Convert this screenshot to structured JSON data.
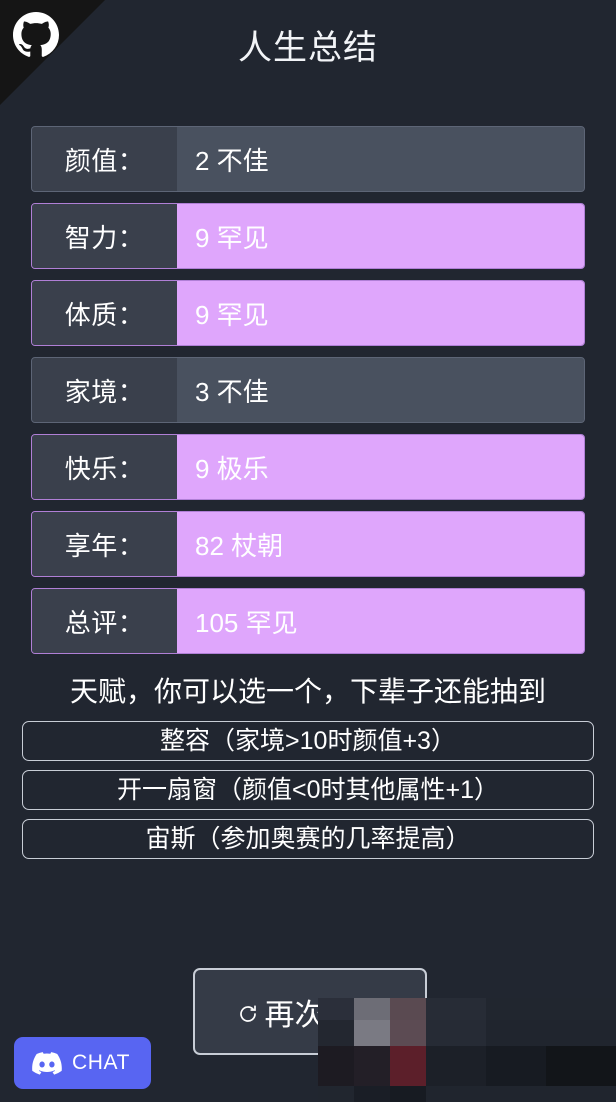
{
  "header": {
    "title": "人生总结",
    "corner_icon": "github-octocat-icon"
  },
  "stats": {
    "rows": [
      {
        "label": "颜值：",
        "value": "2 不佳",
        "highlight": false
      },
      {
        "label": "智力：",
        "value": "9 罕见",
        "highlight": true
      },
      {
        "label": "体质：",
        "value": "9 罕见",
        "highlight": true
      },
      {
        "label": "家境：",
        "value": "3 不佳",
        "highlight": false
      },
      {
        "label": "快乐：",
        "value": "9 极乐",
        "highlight": true
      },
      {
        "label": "享年：",
        "value": "82 杖朝",
        "highlight": true
      },
      {
        "label": "总评：",
        "value": "105 罕见",
        "highlight": true
      }
    ]
  },
  "talents": {
    "hint": "天赋，你可以选一个，下辈子还能抽到",
    "options": [
      "整容（家境>10时颜值+3）",
      "开一扇窗（颜值<0时其他属性+1）",
      "宙斯（参加奥赛的几率提高）"
    ]
  },
  "restart": {
    "label": "再次重开",
    "icon": "reload-icon"
  },
  "discord": {
    "label": "CHAT",
    "icon": "discord-icon"
  },
  "colors": {
    "background": "#212630",
    "row_label_bg": "#3a404c",
    "row_value_bg": "#49515f",
    "highlight_bg": "#dfa6fc",
    "border": "#5d6576",
    "discord_brand": "#5865f2",
    "corner_ribbon": "#151515"
  }
}
